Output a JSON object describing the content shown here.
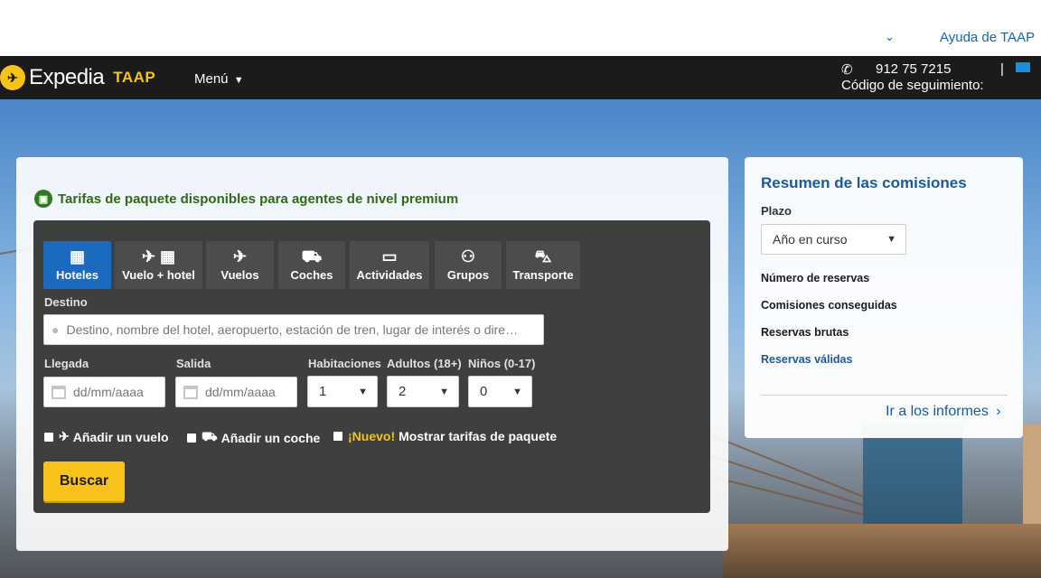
{
  "topbar": {
    "help_label": "Ayuda de TAAP"
  },
  "header": {
    "logo_text": "Expedia",
    "logo_taap": "TAAP",
    "menu_label": "Menú",
    "phone": "912 75 7215",
    "tracking_label": "Código de seguimiento:",
    "divider": "|"
  },
  "promo": {
    "text": "Tarifas de paquete disponibles para agentes de nivel premium"
  },
  "tabs": [
    {
      "label": "Hoteles",
      "icon": "building-icon",
      "glyph": "▦"
    },
    {
      "label": "Vuelo + hotel",
      "icon": "plane-building-icon",
      "glyph": "✈ ▦"
    },
    {
      "label": "Vuelos",
      "icon": "plane-icon",
      "glyph": "✈"
    },
    {
      "label": "Coches",
      "icon": "car-icon",
      "glyph": "⛟"
    },
    {
      "label": "Actividades",
      "icon": "ticket-icon",
      "glyph": "▭"
    },
    {
      "label": "Grupos",
      "icon": "group-icon",
      "glyph": "⚇"
    },
    {
      "label": "Transporte",
      "icon": "bus-icon",
      "glyph": "⛍"
    }
  ],
  "form": {
    "destino_label": "Destino",
    "destino_placeholder": "Destino, nombre del hotel, aeropuerto, estación de tren, lugar de interés o dire…",
    "llegada_label": "Llegada",
    "llegada_placeholder": "dd/mm/aaaa",
    "salida_label": "Salida",
    "salida_placeholder": "dd/mm/aaaa",
    "habitaciones_label": "Habitaciones",
    "habitaciones_value": "1",
    "adultos_label": "Adultos (18+)",
    "adultos_value": "2",
    "ninos_label": "Niños (0-17)",
    "ninos_value": "0",
    "add_flight": "Añadir un vuelo",
    "add_car": "Añadir un coche",
    "new_badge": "¡Nuevo!",
    "show_packages": "Mostrar tarifas de paquete",
    "search_label": "Buscar"
  },
  "panel": {
    "title": "Resumen de las comisiones",
    "plazo_label": "Plazo",
    "plazo_value": "Año en curso",
    "items": [
      "Número de reservas",
      "Comisiones conseguidas",
      "Reservas brutas",
      "Reservas válidas"
    ],
    "report_link": "Ir a los informes"
  }
}
